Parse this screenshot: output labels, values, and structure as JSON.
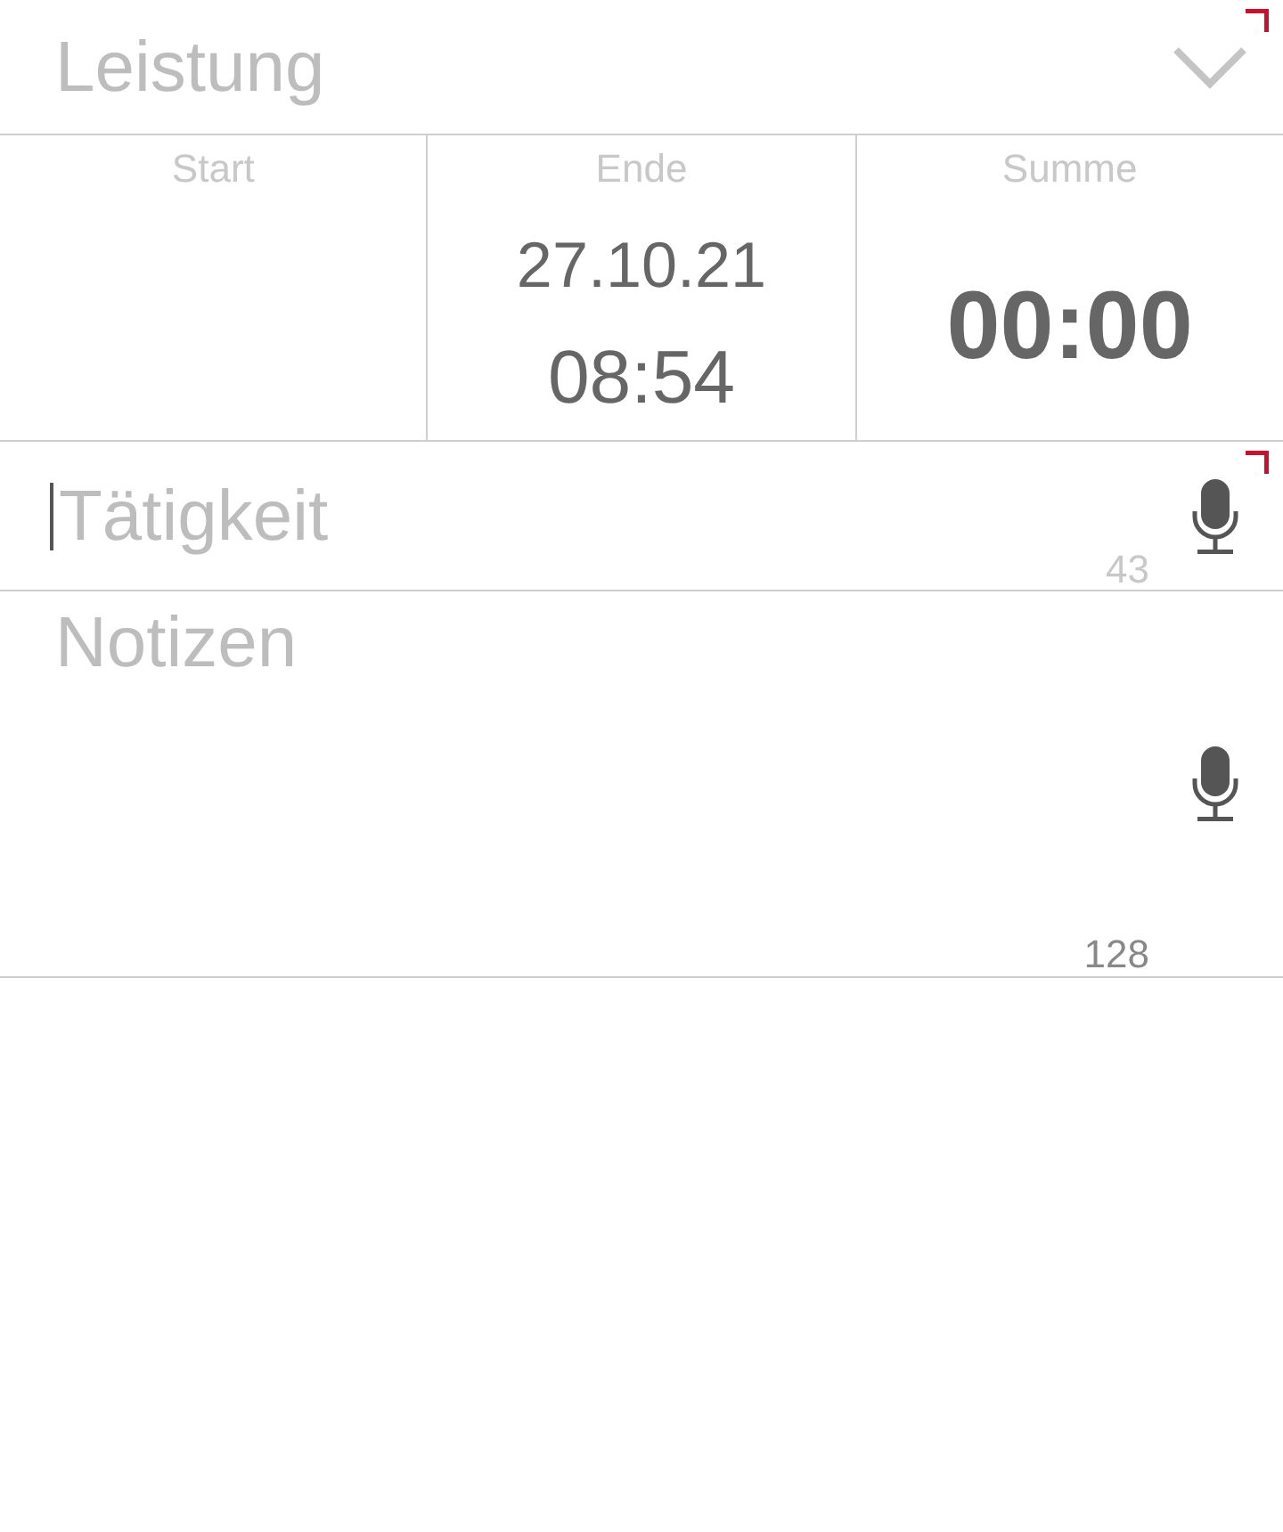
{
  "service_dropdown": {
    "placeholder": "Leistung",
    "required": true
  },
  "time_columns": [
    {
      "kind": "start",
      "label": "Start"
    },
    {
      "kind": "end",
      "label": "Ende",
      "date": "27.10.21",
      "time": "08:54"
    },
    {
      "kind": "total",
      "label": "Summe",
      "value": "00:00"
    }
  ],
  "fields": [
    {
      "kind": "single_line",
      "placeholder": "Tätigkeit",
      "counter": "43",
      "required": true,
      "focused": true
    },
    {
      "kind": "multi_line",
      "placeholder": "Notizen",
      "counter": "128",
      "required": false,
      "focused": false
    }
  ]
}
